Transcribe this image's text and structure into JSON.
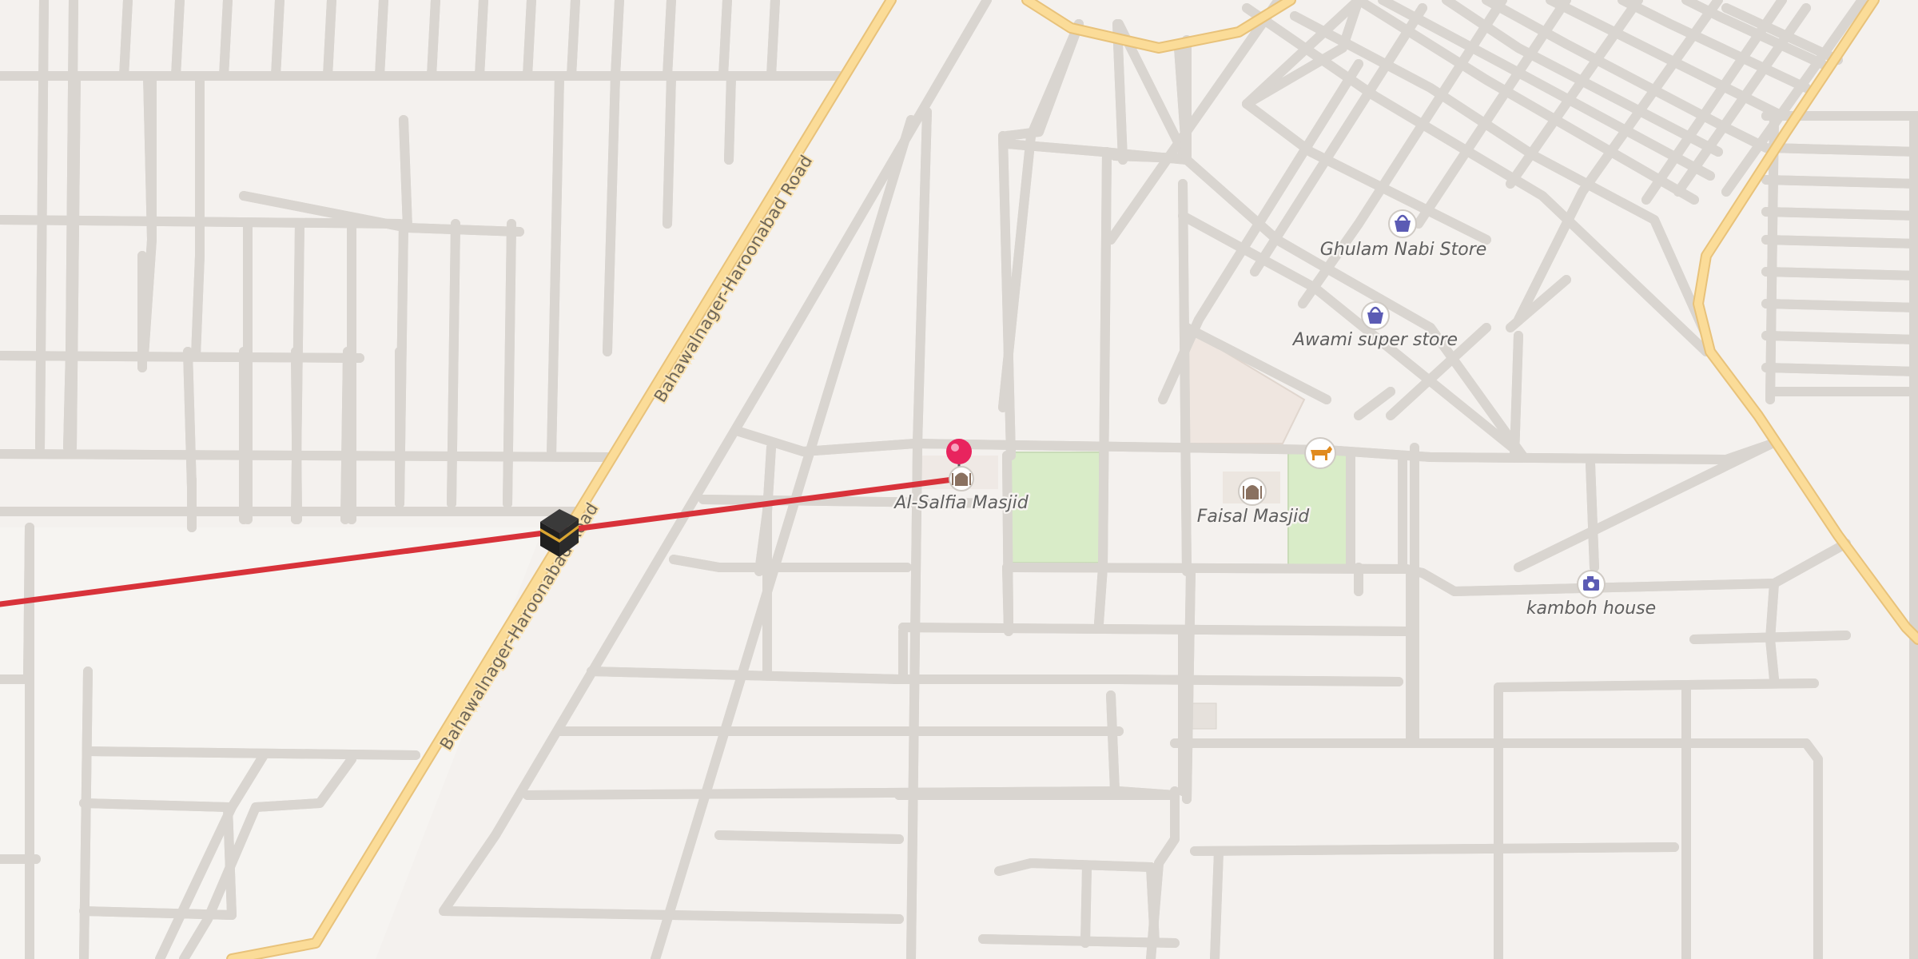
{
  "map": {
    "roads": [
      {
        "name": "Bahawalnager-Haroonabad Road"
      },
      {
        "name": "Bahawalnager-Haroonabad Road"
      }
    ],
    "places": [
      {
        "key": "al-salfia-masjid",
        "label": "Al-Salfia Masjid",
        "icon": "mosque-icon"
      },
      {
        "key": "faisal-masjid",
        "label": "Faisal Masjid",
        "icon": "mosque-icon"
      },
      {
        "key": "ghulam-nabi-store",
        "label": "Ghulam Nabi Store",
        "icon": "shopping-basket-icon"
      },
      {
        "key": "awami-super-store",
        "label": "Awami super store",
        "icon": "shopping-basket-icon"
      },
      {
        "key": "kamboh-house",
        "label": "kamboh house",
        "icon": "camera-icon"
      },
      {
        "key": "cattle-market",
        "label": "",
        "icon": "cow-icon"
      }
    ],
    "colors": {
      "background": "#f4f1ee",
      "street": "#ffffff",
      "street_casing": "#d9d5d0",
      "main_road": "#fbdc98",
      "main_road_casing": "#e8c27a",
      "park": "#d9ecc8",
      "qibla_line": "#d8323a",
      "pin": "#e8245e",
      "poi_icon": "#5b5bb4"
    },
    "qibla_marker_icon": "kaaba-icon",
    "pin_icon": "location-pin-icon"
  }
}
